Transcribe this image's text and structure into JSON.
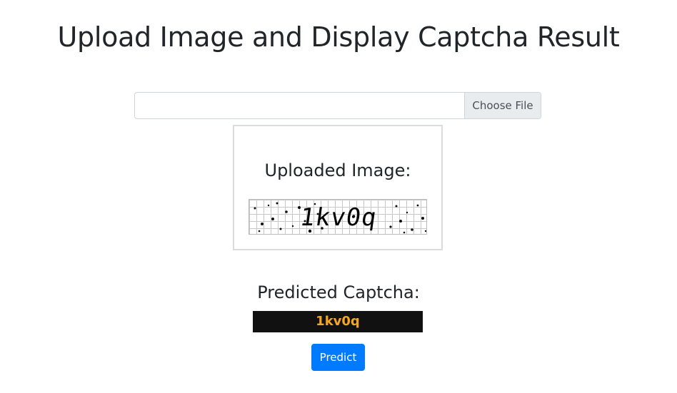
{
  "header": {
    "title": "Upload Image and Display Captcha Result"
  },
  "upload": {
    "file_name": "",
    "choose_label": "Choose File"
  },
  "preview": {
    "heading": "Uploaded Image:",
    "captcha_text": "1kv0q"
  },
  "result": {
    "heading": "Predicted Captcha:",
    "value": "1kv0q"
  },
  "actions": {
    "predict_label": "Predict"
  },
  "colors": {
    "primary": "#007bff",
    "result_bg": "#111111",
    "result_text": "#f5a623"
  }
}
